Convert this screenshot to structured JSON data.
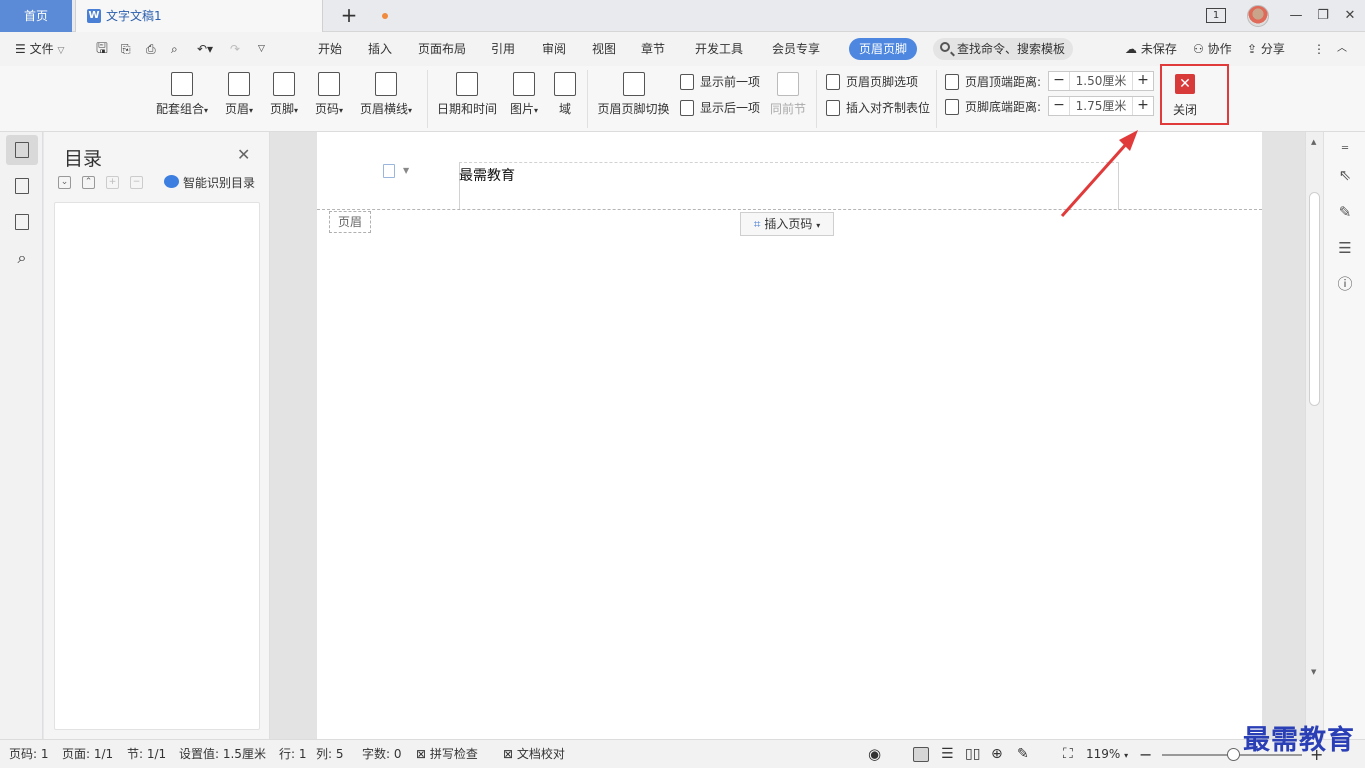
{
  "titlebar": {
    "home_tab": "首页",
    "doc_tab": "文字文稿1",
    "doc_icon": "W",
    "add_tab": "+",
    "page_badge": "1"
  },
  "menubar": {
    "file_label": "文件",
    "tabs": [
      "开始",
      "插入",
      "页面布局",
      "引用",
      "审阅",
      "视图",
      "章节",
      "开发工具",
      "会员专享"
    ],
    "active_tab": "页眉页脚",
    "search_placeholder": "查找命令、搜索模板",
    "unsaved": "未保存",
    "collab": "协作",
    "share": "分享"
  },
  "ribbon": {
    "combo": "配套组合",
    "header": "页眉",
    "footer": "页脚",
    "page_number": "页码",
    "header_line": "页眉横线",
    "datetime": "日期和时间",
    "picture": "图片",
    "field": "域",
    "switch": "页眉页脚切换",
    "show_prev": "显示前一项",
    "show_next": "显示后一项",
    "same_prev": "同前节",
    "options": "页眉页脚选项",
    "align_tab": "插入对齐制表位",
    "top_dist_label": "页眉顶端距离:",
    "top_dist_value": "1.50厘米",
    "bottom_dist_label": "页脚底端距离:",
    "bottom_dist_value": "1.75厘米",
    "close": "关闭"
  },
  "toc": {
    "title": "目录",
    "ai_label": "智能识别目录"
  },
  "document": {
    "header_text": "最需教育",
    "header_tag": "页眉",
    "insert_page_number": "插入页码"
  },
  "statusbar": {
    "page_num": "页码: 1",
    "pages": "页面: 1/1",
    "section": "节: 1/1",
    "setting": "设置值: 1.5厘米",
    "row": "行: 1",
    "col": "列: 5",
    "words": "字数: 0",
    "spell": "拼写检查",
    "proof": "文档校对",
    "zoom": "119%"
  },
  "watermark": "最需教育",
  "colors": {
    "accent": "#4d87e0",
    "close_red": "#d83a3a",
    "annotation_red": "#e13a3a"
  }
}
